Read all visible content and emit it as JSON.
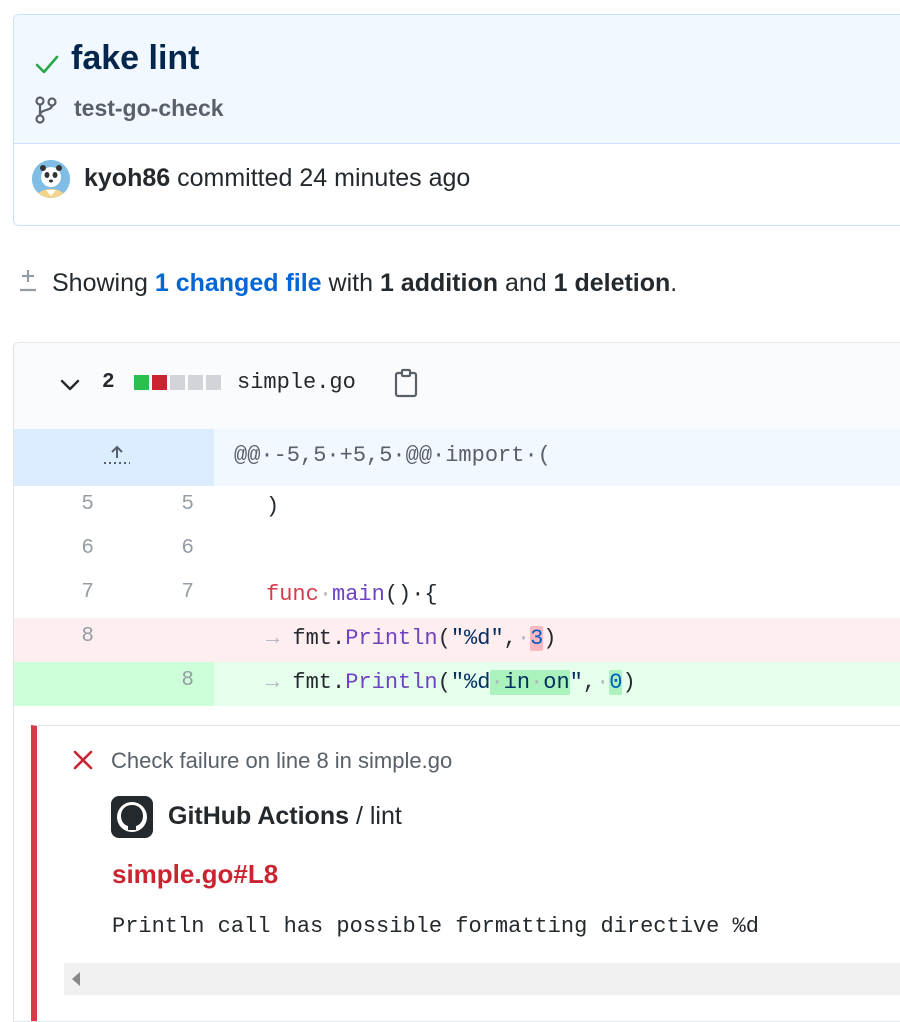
{
  "commit": {
    "title": "fake lint",
    "branch": "test-go-check",
    "author": "kyoh86",
    "action_text": " committed ",
    "time_ago": "24 minutes ago"
  },
  "toc": {
    "prefix": "Showing ",
    "changed_files": "1 changed file",
    "mid1": " with ",
    "additions": "1 addition",
    "mid2": " and ",
    "deletions": "1 deletion",
    "suffix": "."
  },
  "file": {
    "diffstat_count": "2",
    "diffstat_blocks": [
      "#2cbe4e",
      "#cb2431",
      "#d1d5da",
      "#d1d5da",
      "#d1d5da"
    ],
    "name": "simple.go",
    "hunk_header": "@@·-5,5·+5,5·@@·import·(",
    "lines": [
      {
        "old": "5",
        "new": "5",
        "code": ")"
      },
      {
        "old": "6",
        "new": "6",
        "code": ""
      },
      {
        "old": "7",
        "new": "7",
        "code_kw": "func",
        "code_fn": "main",
        "code_rest": "()·{"
      },
      {
        "old": "8",
        "new": "",
        "type": "del"
      },
      {
        "old": "",
        "new": "8",
        "type": "add"
      }
    ]
  },
  "annotation": {
    "title": "Check failure on line 8 in simple.go",
    "app_name": "GitHub Actions",
    "check_name": " / lint",
    "link": "simple.go#L8",
    "message": "Println call has possible formatting directive %d"
  },
  "colors": {
    "success": "#28a745",
    "failure": "#cb2431",
    "link": "#0366d6"
  }
}
